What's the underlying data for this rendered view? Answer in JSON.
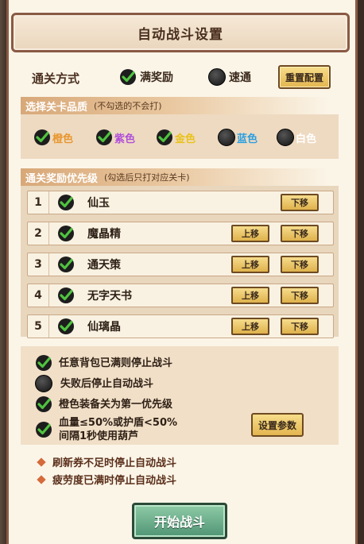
{
  "window": {
    "title": "自动战斗设置"
  },
  "clear_mode": {
    "label": "通关方式",
    "options": [
      {
        "label": "满奖励",
        "checked": true
      },
      {
        "label": "速通",
        "checked": false
      }
    ],
    "reset_label": "重置配置"
  },
  "quality": {
    "title": "选择关卡品质",
    "subtitle": "(不勾选的不会打)",
    "options": [
      {
        "label": "橙色",
        "checked": true,
        "color": "#e8962e"
      },
      {
        "label": "紫色",
        "checked": true,
        "color": "#b04fd8"
      },
      {
        "label": "金色",
        "checked": true,
        "color": "#e9c21a"
      },
      {
        "label": "蓝色",
        "checked": false,
        "color": "#2e9fe0"
      },
      {
        "label": "白色",
        "checked": false,
        "color": "#ffffff"
      }
    ]
  },
  "rewards": {
    "title": "通关奖励优先级",
    "subtitle": "(勾选后只打对应关卡)",
    "up_label": "上移",
    "down_label": "下移",
    "rows": [
      {
        "num": "1",
        "name": "仙玉",
        "checked": true
      },
      {
        "num": "2",
        "name": "魔晶精",
        "checked": true
      },
      {
        "num": "3",
        "name": "通天策",
        "checked": true
      },
      {
        "num": "4",
        "name": "无字天书",
        "checked": true
      },
      {
        "num": "5",
        "name": "仙璃晶",
        "checked": true
      }
    ]
  },
  "options": {
    "items": [
      {
        "text": "任意背包已满则停止战斗",
        "checked": true
      },
      {
        "text": "失败后停止自动战斗",
        "checked": false
      },
      {
        "text": "橙色装备关为第一优先级",
        "checked": true
      }
    ],
    "gourd": {
      "line1": "血量≤50%或护盾<50%",
      "line2": "间隔1秒使用葫芦",
      "checked": true
    },
    "param_label": "设置参数"
  },
  "notes": [
    "刷新券不足时停止自动战斗",
    "疲劳度已满时停止自动战斗"
  ],
  "start_label": "开始战斗",
  "colors": {
    "accent_green": "#2f8f3a",
    "panel_border": "#8a5a44",
    "button_gold": "#e3b650"
  }
}
